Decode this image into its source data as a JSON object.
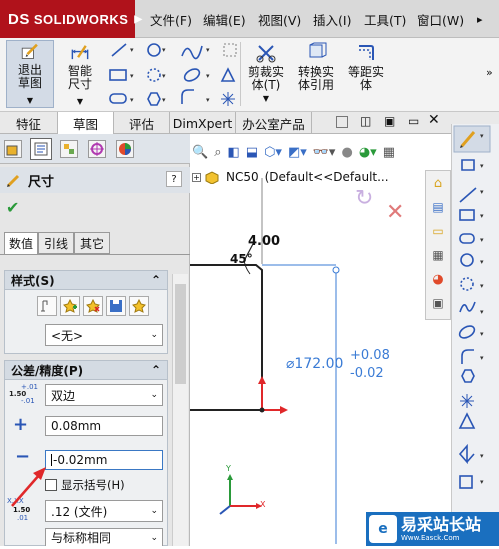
{
  "app": {
    "title": "SOLIDWORKS"
  },
  "menu": [
    "文件(F)",
    "编辑(E)",
    "视图(V)",
    "插入(I)",
    "工具(T)",
    "窗口(W)"
  ],
  "ribbon": {
    "exit_sketch": "退出草图",
    "smart_dim": "智能尺寸",
    "trim": "剪裁实体(T)",
    "convert": "转换实体引用",
    "offset": "等距实体"
  },
  "tabs": [
    "特征",
    "草图",
    "评估",
    "DimXpert",
    "办公室产品"
  ],
  "pm": {
    "title": "尺寸",
    "help": "?",
    "subtabs": [
      "数值",
      "引线",
      "其它"
    ],
    "style_group": "样式(S)",
    "style_value": "<无>",
    "tol_group": "公差/精度(P)",
    "tol_type": "双边",
    "upper": "0.08mm",
    "lower": "-0.02mm",
    "show_paren": "显示括号(H)",
    "precision": ".12 (文件)",
    "tol_precision": "与标称相同",
    "icon_labels": {
      "tol_top": "1.50",
      "tol_sup": "+.01",
      "tol_sub": "-.01",
      "prec_a": "X.XX",
      "prec_b": "1.50",
      "prec_c": ".01"
    }
  },
  "tree": {
    "part": "NC50",
    "config": "(Default<<Default..."
  },
  "sketch": {
    "angle": "45°",
    "dim_small": "4.00",
    "diameter": "⌀172.00",
    "tol_upper": "+0.08",
    "tol_lower": "-0.02",
    "axis_y": "Y",
    "axis_x": "X"
  },
  "watermark": {
    "cn": "易采站长站",
    "en": "Www.Easck.Com"
  },
  "colors": {
    "accent": "#b0121b",
    "dim_blue": "#3a7bd5",
    "origin_red": "#e0282a"
  }
}
